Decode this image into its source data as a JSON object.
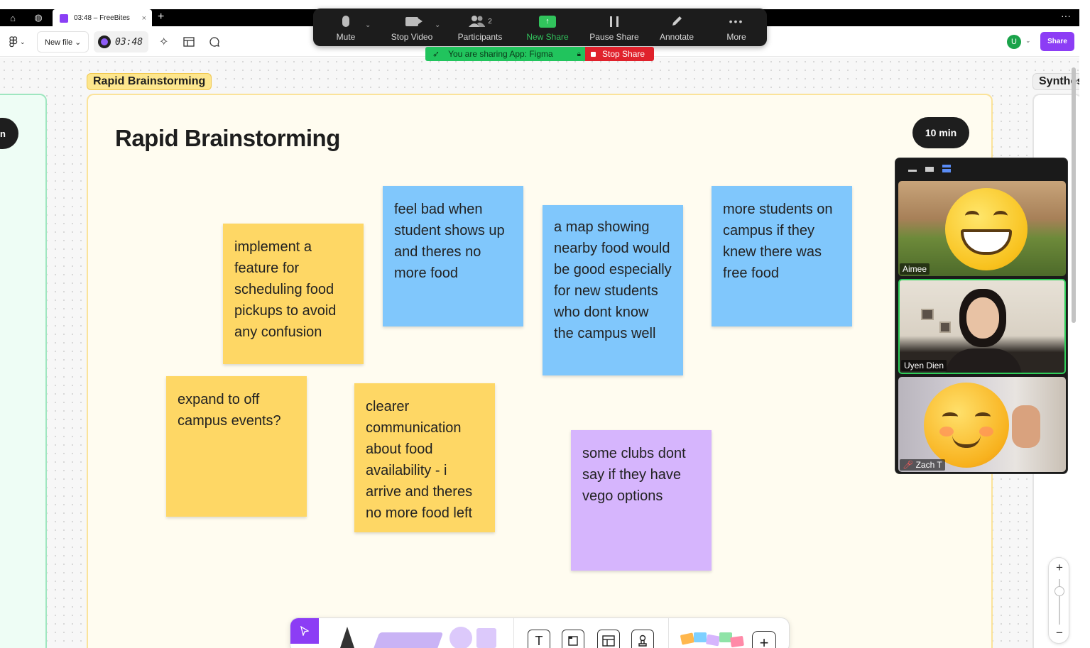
{
  "browser": {
    "tab_title": "03:48 – FreeBites",
    "tab_close": "×",
    "new_tab": "+",
    "more": "···"
  },
  "figma_toolbar": {
    "menu_caret": "⌄",
    "new_file_label": "New file ⌄",
    "timer": "03:48",
    "user_initial": "U",
    "share_label": "Share"
  },
  "zoom_meeting": {
    "controls": [
      {
        "label": "Mute"
      },
      {
        "label": "Stop Video"
      },
      {
        "label": "Participants",
        "count": "2"
      },
      {
        "label": "New Share"
      },
      {
        "label": "Pause Share"
      },
      {
        "label": "Annotate"
      },
      {
        "label": "More"
      }
    ],
    "sharing_banner": "You are sharing App: Figma",
    "stop_share_label": "Stop Share"
  },
  "canvas": {
    "frame_label": "Rapid Brainstorming",
    "frame_title": "Rapid Brainstorming",
    "time_pill": "10 min",
    "left_pill_text": "n",
    "right_frame_label": "Synthesis"
  },
  "stickies": [
    {
      "color": "yellow",
      "text": "implement a feature for scheduling food pickups to avoid any confusion"
    },
    {
      "color": "blue",
      "text": "feel bad when student shows up and theres no more food"
    },
    {
      "color": "blue",
      "text": "a map showing nearby food would be good especially for new students who dont know the campus well"
    },
    {
      "color": "blue",
      "text": "more students on campus if they knew there was free food"
    },
    {
      "color": "yellow",
      "text": "expand to off campus events?"
    },
    {
      "color": "yellow",
      "text": "clearer communication about food availability - i arrive and theres no more food left"
    },
    {
      "color": "purple",
      "text": "some clubs dont say if they have vego options"
    }
  ],
  "participants": [
    {
      "name": "Aimee"
    },
    {
      "name": "Uyen Dien"
    },
    {
      "name": "Zach T"
    }
  ],
  "zoom_control": {
    "plus": "+",
    "minus": "−"
  },
  "colors": {
    "sticky_yellow": "#fed765",
    "sticky_blue": "#80c7fc",
    "sticky_purple": "#d6b5fd",
    "figma_purple": "#8c3df5",
    "zoom_green": "#31c35c",
    "stop_red": "#e0222c"
  }
}
